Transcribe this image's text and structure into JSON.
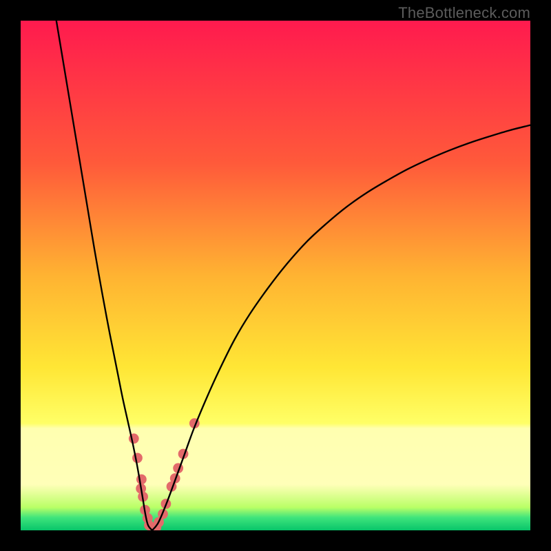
{
  "watermark": "TheBottleneck.com",
  "chart_data": {
    "type": "line",
    "title": "",
    "xlabel": "",
    "ylabel": "",
    "xlim": [
      0,
      100
    ],
    "ylim": [
      0,
      100
    ],
    "gradient_stops": [
      {
        "offset": 0.0,
        "color": "#ff1a4e"
      },
      {
        "offset": 0.28,
        "color": "#ff5a3a"
      },
      {
        "offset": 0.5,
        "color": "#ffb332"
      },
      {
        "offset": 0.68,
        "color": "#ffe635"
      },
      {
        "offset": 0.79,
        "color": "#ffff66"
      },
      {
        "offset": 0.8,
        "color": "#ffffb0"
      },
      {
        "offset": 0.91,
        "color": "#ffffb8"
      },
      {
        "offset": 0.955,
        "color": "#b9ff66"
      },
      {
        "offset": 0.975,
        "color": "#3fe47c"
      },
      {
        "offset": 1.0,
        "color": "#07c56a"
      }
    ],
    "series": [
      {
        "name": "left-branch",
        "type": "line",
        "points": [
          {
            "x": 7.0,
            "y": 100.0
          },
          {
            "x": 8.5,
            "y": 91.0
          },
          {
            "x": 10.0,
            "y": 82.0
          },
          {
            "x": 11.5,
            "y": 73.0
          },
          {
            "x": 13.0,
            "y": 64.0
          },
          {
            "x": 14.5,
            "y": 55.0
          },
          {
            "x": 16.0,
            "y": 46.5
          },
          {
            "x": 17.5,
            "y": 38.5
          },
          {
            "x": 19.0,
            "y": 31.0
          },
          {
            "x": 20.0,
            "y": 26.0
          },
          {
            "x": 21.0,
            "y": 21.5
          },
          {
            "x": 22.0,
            "y": 17.0
          },
          {
            "x": 22.8,
            "y": 13.0
          },
          {
            "x": 23.5,
            "y": 9.0
          },
          {
            "x": 24.0,
            "y": 6.0
          },
          {
            "x": 24.5,
            "y": 3.0
          },
          {
            "x": 25.0,
            "y": 1.0
          },
          {
            "x": 25.812,
            "y": 0.0
          }
        ]
      },
      {
        "name": "right-branch",
        "type": "line",
        "points": [
          {
            "x": 25.812,
            "y": 0.0
          },
          {
            "x": 27.0,
            "y": 1.5
          },
          {
            "x": 28.5,
            "y": 5.0
          },
          {
            "x": 30.0,
            "y": 9.0
          },
          {
            "x": 32.0,
            "y": 14.5
          },
          {
            "x": 34.0,
            "y": 20.0
          },
          {
            "x": 36.5,
            "y": 26.0
          },
          {
            "x": 39.0,
            "y": 31.5
          },
          {
            "x": 42.0,
            "y": 37.5
          },
          {
            "x": 45.0,
            "y": 42.5
          },
          {
            "x": 48.5,
            "y": 47.5
          },
          {
            "x": 52.0,
            "y": 52.0
          },
          {
            "x": 56.0,
            "y": 56.5
          },
          {
            "x": 60.0,
            "y": 60.2
          },
          {
            "x": 64.0,
            "y": 63.5
          },
          {
            "x": 68.0,
            "y": 66.3
          },
          {
            "x": 72.0,
            "y": 68.7
          },
          {
            "x": 76.0,
            "y": 70.9
          },
          {
            "x": 80.0,
            "y": 72.8
          },
          {
            "x": 84.0,
            "y": 74.5
          },
          {
            "x": 88.0,
            "y": 76.0
          },
          {
            "x": 92.0,
            "y": 77.3
          },
          {
            "x": 96.0,
            "y": 78.5
          },
          {
            "x": 100.0,
            "y": 79.5
          }
        ]
      }
    ],
    "markers": {
      "name": "highlight-dots",
      "color": "#e36a6a",
      "radius_data_units": 1.0,
      "points": [
        {
          "x": 22.2,
          "y": 18.0
        },
        {
          "x": 22.9,
          "y": 14.2
        },
        {
          "x": 23.7,
          "y": 10.0
        },
        {
          "x": 23.6,
          "y": 8.2
        },
        {
          "x": 24.0,
          "y": 6.6
        },
        {
          "x": 24.4,
          "y": 4.0
        },
        {
          "x": 24.9,
          "y": 2.4
        },
        {
          "x": 25.2,
          "y": 1.0
        },
        {
          "x": 26.6,
          "y": 0.6
        },
        {
          "x": 27.1,
          "y": 1.6
        },
        {
          "x": 27.9,
          "y": 3.2
        },
        {
          "x": 28.5,
          "y": 5.2
        },
        {
          "x": 29.6,
          "y": 8.6
        },
        {
          "x": 30.3,
          "y": 10.2
        },
        {
          "x": 30.9,
          "y": 12.2
        },
        {
          "x": 31.9,
          "y": 15.0
        },
        {
          "x": 34.1,
          "y": 21.0
        }
      ]
    }
  }
}
